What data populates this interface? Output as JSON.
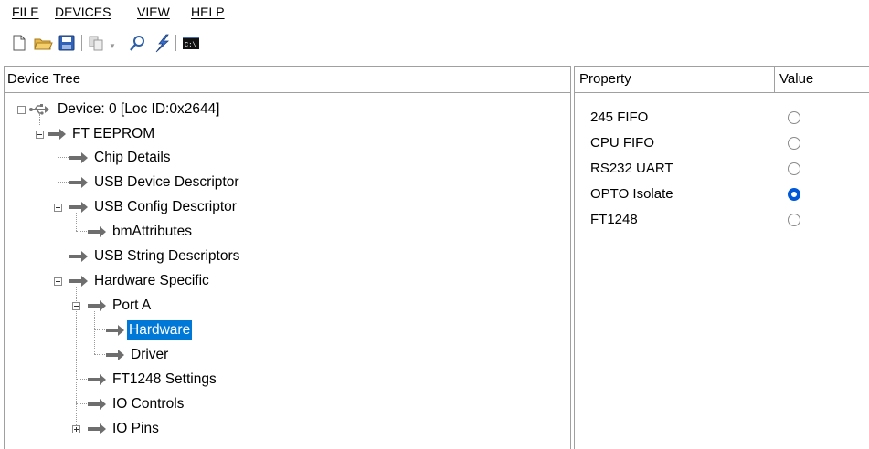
{
  "menu": {
    "file": "FILE",
    "devices": "DEVICES",
    "view": "VIEW",
    "help": "HELP"
  },
  "toolbar": {
    "icons": [
      "new-file-icon",
      "open-folder-icon",
      "save-icon",
      "copy-icon",
      "search-icon",
      "program-icon",
      "console-icon"
    ]
  },
  "tree": {
    "header": "Device Tree",
    "nodes": {
      "device": "Device: 0 [Loc ID:0x2644]",
      "ft_eeprom": "FT EEPROM",
      "chip_details": "Chip Details",
      "usb_device_descriptor": "USB Device Descriptor",
      "usb_config_descriptor": "USB Config Descriptor",
      "bm_attributes": "bmAttributes",
      "usb_string_descriptors": "USB String Descriptors",
      "hardware_specific": "Hardware Specific",
      "port_a": "Port A",
      "hardware": "Hardware",
      "driver": "Driver",
      "ft1248_settings": "FT1248 Settings",
      "io_controls": "IO Controls",
      "io_pins": "IO Pins"
    },
    "selected": "hardware"
  },
  "properties": {
    "header_property": "Property",
    "header_value": "Value",
    "rows": [
      {
        "label": "245 FIFO",
        "checked": false
      },
      {
        "label": "CPU FIFO",
        "checked": false
      },
      {
        "label": "RS232 UART",
        "checked": false
      },
      {
        "label": "OPTO Isolate",
        "checked": true
      },
      {
        "label": "FT1248",
        "checked": false
      }
    ]
  },
  "colors": {
    "selection": "#0078d7",
    "radio_checked": "#0057d8",
    "arrow": "#6e6e6e"
  }
}
